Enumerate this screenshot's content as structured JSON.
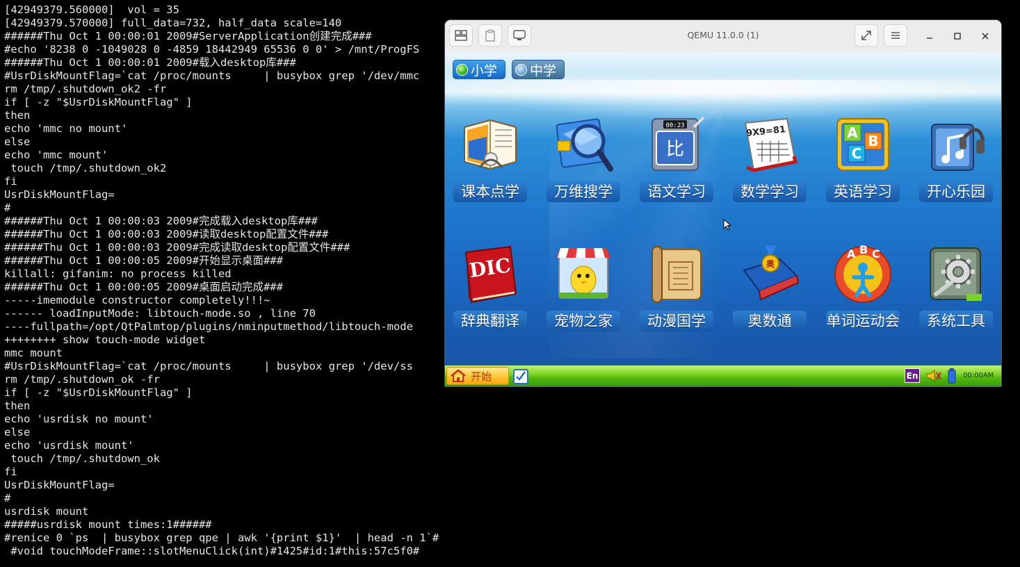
{
  "terminal": {
    "lines": [
      "[42949379.560000]  vol = 35",
      "[42949379.570000] full_data=732, half_data scale=140",
      "######Thu Oct 1 00:00:01 2009#ServerApplication创建完成###",
      "#echo '8238 0 -1049028 0 -4859 18442949 65536 0 0' > /mnt/ProgFS",
      "######Thu Oct 1 00:00:01 2009#载入desktop库###",
      "#UsrDiskMountFlag=`cat /proc/mounts     | busybox grep '/dev/mmc",
      "rm /tmp/.shutdown_ok2 -fr",
      "if [ -z \"$UsrDiskMountFlag\" ]",
      "then",
      "echo 'mmc no mount'",
      "else",
      "echo 'mmc mount'",
      " touch /tmp/.shutdown_ok2",
      "fi",
      "UsrDiskMountFlag=",
      "#",
      "######Thu Oct 1 00:00:03 2009#完成载入desktop库###",
      "######Thu Oct 1 00:00:03 2009#读取desktop配置文件###",
      "######Thu Oct 1 00:00:03 2009#完成读取desktop配置文件###",
      "######Thu Oct 1 00:00:05 2009#开始显示桌面###",
      "killall: gifanim: no process killed",
      "######Thu Oct 1 00:00:05 2009#桌面启动完成###",
      "-----imemodule constructor completely!!!~",
      "------ loadInputMode: libtouch-mode.so , line 70",
      "----fullpath=/opt/QtPalmtop/plugins/nminputmethod/libtouch-mode",
      "++++++++ show touch-mode widget",
      "mmc mount",
      "#UsrDiskMountFlag=`cat /proc/mounts     | busybox grep '/dev/ss",
      "rm /tmp/.shutdown_ok -fr",
      "if [ -z \"$UsrDiskMountFlag\" ]",
      "then",
      "echo 'usrdisk no mount'",
      "else",
      "echo 'usrdisk mount'",
      " touch /tmp/.shutdown_ok",
      "fi",
      "UsrDiskMountFlag=",
      "#",
      "usrdisk mount",
      "#####usrdisk mount times:1######",
      "#renice 0 `ps  | busybox grep qpe | awk '{print $1}'  | head -n 1`#",
      " #void touchModeFrame::slotMenuClick(int)#1425#id:1#this:57c5f0#"
    ]
  },
  "qemu": {
    "title": "QEMU 11.0.0 (1)",
    "toolbar_icons": [
      "view-split-icon",
      "clipboard-icon",
      "display-icon"
    ],
    "right_icons": [
      "fullscreen-icon",
      "menu-icon"
    ],
    "window_controls": [
      "minimize-icon",
      "maximize-icon",
      "close-icon"
    ]
  },
  "guest": {
    "tabs": [
      {
        "label": "小学",
        "selected": true
      },
      {
        "label": "中学",
        "selected": false
      }
    ],
    "apps_row1": [
      {
        "label": "课本点学",
        "icon": "book-headphones-icon"
      },
      {
        "label": "万维搜学",
        "icon": "magnifier-icon"
      },
      {
        "label": "语文学习",
        "icon": "chinese-tablet-icon"
      },
      {
        "label": "数学学习",
        "icon": "math-book-icon"
      },
      {
        "label": "英语学习",
        "icon": "abc-blocks-icon"
      },
      {
        "label": "开心乐园",
        "icon": "music-headphones-icon"
      }
    ],
    "apps_row2": [
      {
        "label": "辞典翻译",
        "icon": "dictionary-icon"
      },
      {
        "label": "宠物之家",
        "icon": "pet-chick-icon"
      },
      {
        "label": "动漫国学",
        "icon": "scroll-icon"
      },
      {
        "label": "奥数通",
        "icon": "medal-book-icon"
      },
      {
        "label": "单词运动会",
        "icon": "abc-athlete-icon"
      },
      {
        "label": "系统工具",
        "icon": "gear-tools-icon"
      }
    ],
    "dic_text": "DIC",
    "math_text": "9X9=81",
    "timer_text": "00:23",
    "taskbar": {
      "start_label": "开始",
      "input_method": "En",
      "clock": "00:00AM"
    }
  }
}
